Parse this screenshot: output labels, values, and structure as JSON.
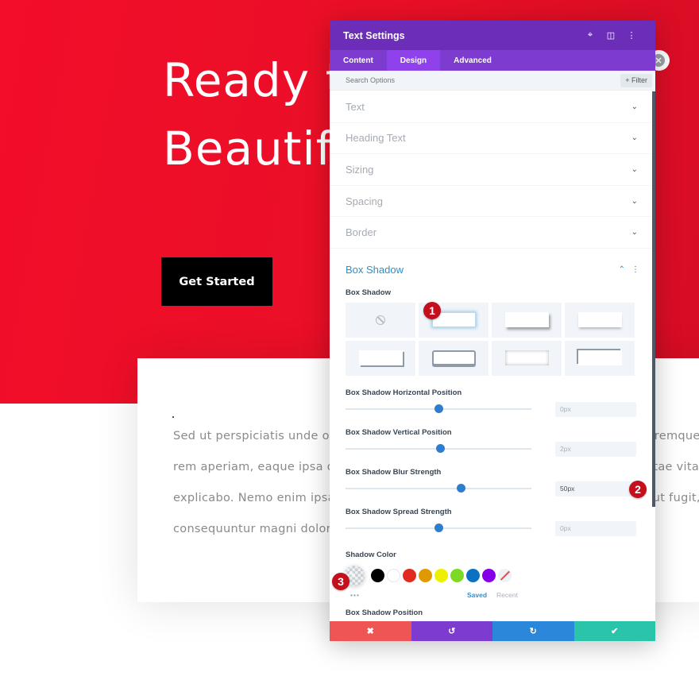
{
  "hero": {
    "title_line1": "Ready to",
    "title_line2": "Beautif",
    "cta_label": "Get Started"
  },
  "card": {
    "lines": [
      "Sed ut perspiciatis unde omnis iste natus error sit voluptatem accusantium doloremque",
      "rem aperiam, eaque ipsa quae ab illo inventore veritatis et quasi architecto beatae vitae dicta",
      "explicabo. Nemo enim ipsam voluptatem quia voluptas sit aspernatur aut odit aut fugit, sed quia",
      "consequuntur magni dolores eos qui ratione voluptatem sequi nesciunt."
    ],
    "right_fragments": [
      "emque",
      "e vitae d",
      ": fugit, s"
    ]
  },
  "panel": {
    "title": "Text Settings",
    "icons": [
      "focus-icon",
      "split-view-icon",
      "more-options-icon"
    ],
    "tabs": [
      {
        "label": "Content",
        "active": false
      },
      {
        "label": "Design",
        "active": true
      },
      {
        "label": "Advanced",
        "active": false
      }
    ],
    "search_placeholder": "Search Options",
    "filter_label": "+ Filter",
    "sections": [
      "Text",
      "Heading Text",
      "Sizing",
      "Spacing",
      "Border"
    ],
    "box_shadow": {
      "title": "Box Shadow",
      "preset_label": "Box Shadow",
      "presets_count": 8,
      "selected_preset": 1,
      "sliders": [
        {
          "label": "Box Shadow Horizontal Position",
          "value": "0px",
          "percent": 50,
          "active": false
        },
        {
          "label": "Box Shadow Vertical Position",
          "value": "2px",
          "percent": 51,
          "active": false
        },
        {
          "label": "Box Shadow Blur Strength",
          "value": "50px",
          "percent": 62,
          "active": true
        },
        {
          "label": "Box Shadow Spread Strength",
          "value": "0px",
          "percent": 50,
          "active": false
        }
      ],
      "color_label": "Shadow Color",
      "swatches": [
        "#000000",
        "#ffffff",
        "#e02b20",
        "#e09900",
        "#edf000",
        "#7cda24",
        "#0c71c3",
        "#8300e9",
        "none"
      ],
      "saved_label": "Saved",
      "recent_label": "Recent",
      "more_label": "•••",
      "position_label": "Box Shadow Position"
    },
    "footer": {
      "cancel": "✖",
      "undo": "↺",
      "redo": "↻",
      "save": "✔"
    }
  },
  "badges": [
    "1",
    "2",
    "3"
  ],
  "colors": {
    "accent_purple": "#6c2eb9",
    "hero_red": "#ea0f27",
    "cancel_red": "#ef5555",
    "undo_purple": "#7e3bd0",
    "redo_blue": "#2b87da",
    "save_green": "#29c4a9"
  }
}
